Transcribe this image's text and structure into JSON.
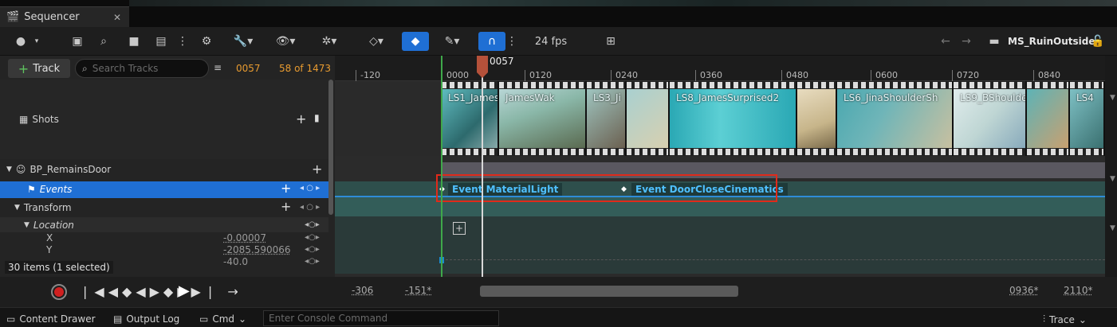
{
  "tab": {
    "title": "Sequencer",
    "close": "✕"
  },
  "toolbar": {
    "fps": "24 fps",
    "sequence_name": "MS_RuinOutside"
  },
  "tracks": {
    "add_label": "Track",
    "search_placeholder": "Search Tracks",
    "current_frame": "0057",
    "frame_count": "58 of 1473",
    "items_status": "30 items (1 selected)",
    "rows": {
      "shots": "Shots",
      "actor": "BP_RemainsDoor",
      "events": "Events",
      "transform": "Transform",
      "location": "Location",
      "x_label": "X",
      "x_value": "-0.00007",
      "y_label": "Y",
      "y_value": "-2085.590066",
      "z_value": "-40.0"
    }
  },
  "ruler": {
    "playhead_label": "0057",
    "ticks": [
      "-120",
      "0000",
      "0120",
      "0240",
      "0360",
      "0480",
      "0600",
      "0720",
      "0840"
    ]
  },
  "shots": [
    {
      "label": "LS1_James",
      "color": "#5fbcc0"
    },
    {
      "label": "JamesWak",
      "color": "#8ab7a8"
    },
    {
      "label": "LS3_Ji",
      "color": "#9fc5c0"
    },
    {
      "label": "",
      "color": "#a9d0d0"
    },
    {
      "label": "LS8_JamesSurprised2",
      "color": "#2aa8b4"
    },
    {
      "label": "",
      "color": "#c7b58a"
    },
    {
      "label": "LS6_JinaShoulderSh",
      "color": "#6fb5b8"
    },
    {
      "label": "LS9_BShoulde",
      "color": "#bfd6d4"
    },
    {
      "label": "",
      "color": "#5db3b6"
    },
    {
      "label": "LS4",
      "color": "#7ec0c4"
    }
  ],
  "events": [
    {
      "label": "Event MaterialLight"
    },
    {
      "label": "Event DoorCloseCinematics"
    }
  ],
  "view_range": {
    "start_outer": "-306",
    "start_inner": "-151*",
    "end_inner": "0936*",
    "end_outer": "2110*"
  },
  "statusbar": {
    "content_drawer": "Content Drawer",
    "output_log": "Output Log",
    "cmd": "Cmd",
    "console_placeholder": "Enter Console Command",
    "trace": "Trace"
  }
}
